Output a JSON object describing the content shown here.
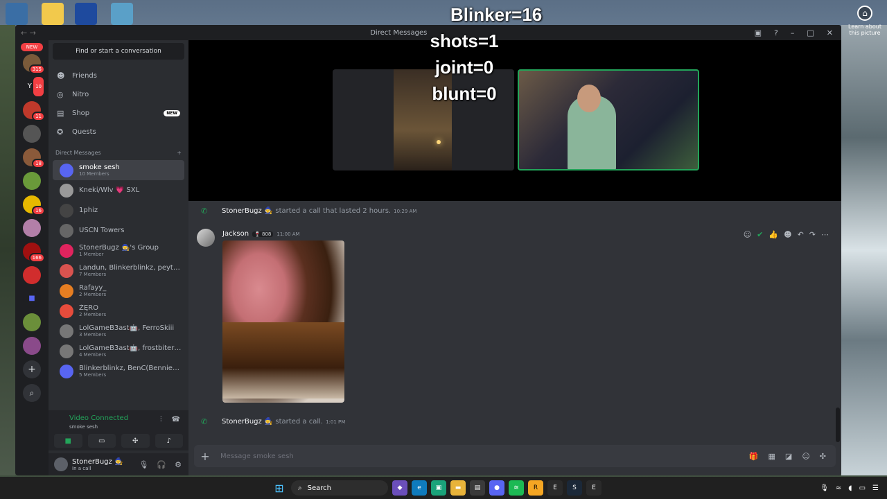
{
  "overlay": {
    "line1": "Blinker=16",
    "line2": "shots=1",
    "line3": "joint=0",
    "line4": "blunt=0"
  },
  "desktop": {
    "learn_about": "Learn about this picture"
  },
  "window": {
    "title": "Direct Messages"
  },
  "servers": {
    "new_label": "NEW",
    "badges": [
      "315",
      "10",
      "11",
      "18",
      "16",
      "166"
    ],
    "ys_label": "YS"
  },
  "sidebar": {
    "search_placeholder": "Find or start a conversation",
    "nav": [
      {
        "label": "Friends",
        "icon": "friends-icon"
      },
      {
        "label": "Nitro",
        "icon": "nitro-icon"
      },
      {
        "label": "Shop",
        "icon": "shop-icon",
        "tag": "NEW"
      },
      {
        "label": "Quests",
        "icon": "quests-icon"
      }
    ],
    "dm_header": "Direct Messages",
    "dms": [
      {
        "name": "smoke sesh",
        "sub": "10 Members"
      },
      {
        "name": "Kneki/Wlv 💗 SXL",
        "sub": ""
      },
      {
        "name": "1phiz",
        "sub": ""
      },
      {
        "name": "USCN Towers",
        "sub": ""
      },
      {
        "name": "StonerBugz 🧙's Group",
        "sub": "1 Member"
      },
      {
        "name": "Landun, Blinkerblinkz, peytonia...",
        "sub": "7 Members"
      },
      {
        "name": "Rafayy_",
        "sub": "2 Members"
      },
      {
        "name": "ŽĘRÖ",
        "sub": "2 Members"
      },
      {
        "name": "LolGameB3ast🤖, FerroSkiii",
        "sub": "3 Members"
      },
      {
        "name": "LolGameB3ast🤖, frostbiter23...",
        "sub": "4 Members"
      },
      {
        "name": "Blinkerblinkz, BenC(BennieC), v...",
        "sub": "5 Members"
      }
    ]
  },
  "voice": {
    "status": "Video Connected",
    "channel": "smoke sesh"
  },
  "user": {
    "name": "StonerBugz 🧙",
    "status": "In a call"
  },
  "chat": {
    "call1": {
      "who": "StonerBugz 🧙",
      "text": "started a call that lasted 2 hours.",
      "time": "10:29 AM"
    },
    "message": {
      "author": "Jackson",
      "badge": "🍷 808",
      "time": "11:00 AM"
    },
    "call2": {
      "who": "StonerBugz 🧙",
      "text": "started a call.",
      "time": "1:01 PM"
    },
    "input_placeholder": "Message smoke sesh"
  },
  "taskbar": {
    "search_label": "Search"
  },
  "colors": {
    "accent_green": "#23a55a",
    "badge_red": "#f23f43",
    "main_bg": "#313338",
    "sidebar_bg": "#2b2d31"
  }
}
